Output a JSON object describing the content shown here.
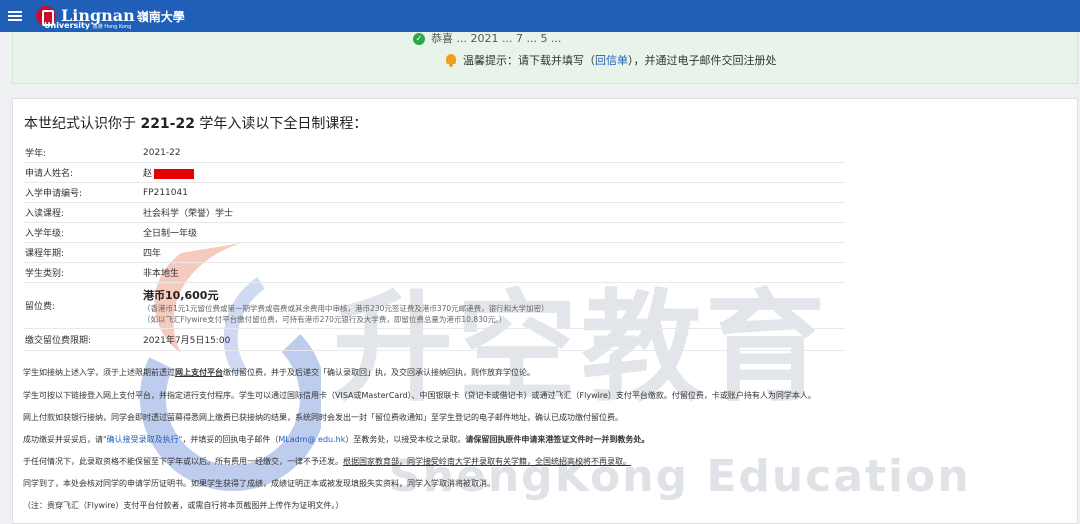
{
  "header": {
    "logo_en": "Lingnan",
    "logo_cjk": "嶺南大學",
    "logo_sub_en": "University",
    "logo_sub_cjk": "香港 Hong Kong"
  },
  "notice": {
    "top_text": "恭喜 ... 2021 ... 7 ... 5 ...",
    "prompt_label": "温馨提示：请下载并填写（",
    "form_link": "回信单",
    "prompt_tail": "），并通过电子邮件交回注册处"
  },
  "card": {
    "title_pre": "本世纪式认识你于 ",
    "title_year": "221-22",
    "title_post": " 学年入读以下全日制课程："
  },
  "info_rows": [
    {
      "label": "学年:",
      "value": "2021-22"
    },
    {
      "label": "申请人姓名:",
      "value": "赵"
    },
    {
      "label": "入学申请编号:",
      "value": "FP211041"
    },
    {
      "label": "入读课程:",
      "value": "社会科学（荣誉）学士"
    },
    {
      "label": "入学年级:",
      "value": "全日制一年级"
    },
    {
      "label": "课程年期:",
      "value": "四年"
    },
    {
      "label": "学生类别:",
      "value": "非本地生"
    }
  ],
  "fee": {
    "label": "留位费:",
    "amount": "港币10,600元",
    "note1": "（香港币1元1元留位费或第一期学费或宿费或其余费用中审核，港币230元签证费及港币370元邮递费，银行和大学加密）",
    "note2": "（如以飞汇Flywire支付平台缴付留位费，可持有港币270元银行及大学费，即留位费总量为港币10,830元。）"
  },
  "deadline": {
    "label": "缴交留位费限期:",
    "value": "2021年7月5日15:00"
  },
  "paragraphs": {
    "p1a": "学生如接纳上述入学，须于上述限期前透过",
    "p1b": "网上支付平台",
    "p1c": "缴付留位费，并于及后递交「确认录取回」执，及交回承认接纳回执，则作放弃学位论。",
    "p2": "学生可按以下链接登入网上支付平台，并指定进行支付程序。学生可以通过国际信用卡（VISA或MasterCard）、中国银联卡（贷记卡或借记卡）或通过飞汇（Flywire）支付平台缴款。付留位费，卡或账户持有人为同学本人。",
    "p3": "网上付款如获银行接纳，同学会即时透过萤幕得悉网上缴费已获接纳的结果，系统同时会发出一封「留位费收通知」至学生登记的电子邮件地址，确认已成功缴付留位费。",
    "p4a": "成功缴妥并妥妥后，请",
    "p4b": "\"确认接受录取及执行\"",
    "p4c": "，并填妥的回执电子邮件（",
    "p4d": "MLadm@ edu.hk",
    "p4e": "）至教务处，以接受本校之录取。",
    "p4f": "请保留回执原件申请来港签证文件时一并到教务处。",
    "p5a": "于任何情况下，此录取资格不能保留至下学年或以后。所有费用一经缴交，一律不予还发。",
    "p5b": "根据国家教育部，同学接受岭南大学并录取有关学籍，全国统招高校将不再录取。",
    "p6": "同学到了，本处会核对同学的申请学历证明书。如果学生获得了成绩，成绩证明正本或被发现填报失实资料，同学入学取消将被取消。",
    "p7": "（注：贵穿飞汇（Flywire）支付平台付款者，或需自行将本页截图并上传作为证明文件。）"
  },
  "watermark": {
    "cjk": "升空教育",
    "en": "ShengKong Education"
  },
  "colors": {
    "header_bg": "#1f5fb8",
    "notice_bg": "#e8f4ea",
    "redact": "#e60000"
  }
}
